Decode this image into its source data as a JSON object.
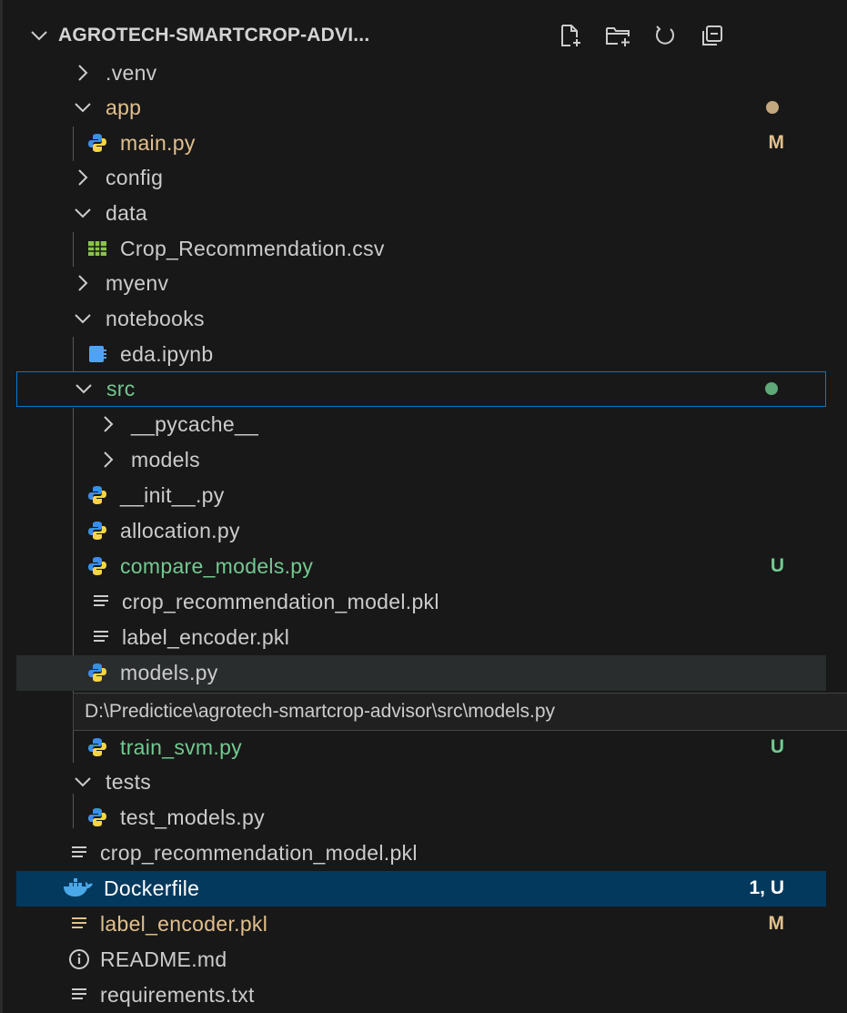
{
  "explorer": {
    "title": "AGROTECH-SMARTCROP-ADVI...",
    "header_icons": [
      "new-file-icon",
      "new-folder-icon",
      "refresh-icon",
      "collapse-all-icon"
    ]
  },
  "tree": {
    "venv": ".venv",
    "app": "app",
    "main_py": "main.py",
    "main_py_badge": "M",
    "config": "config",
    "data": "data",
    "crop_csv": "Crop_Recommendation.csv",
    "myenv": "myenv",
    "notebooks": "notebooks",
    "eda": "eda.ipynb",
    "src": "src",
    "pycache": "__pycache__",
    "models_folder": "models",
    "init_py": "__init__.py",
    "allocation_py": "allocation.py",
    "compare_models_py": "compare_models.py",
    "compare_models_badge": "U",
    "crop_model_pkl_src": "crop_recommendation_model.pkl",
    "label_encoder_pkl_src": "label_encoder.pkl",
    "models_py": "models.py",
    "train_svm_py": "train_svm.py",
    "train_svm_badge": "U",
    "tests": "tests",
    "test_models_py": "test_models.py",
    "crop_model_pkl_root": "crop_recommendation_model.pkl",
    "dockerfile": "Dockerfile",
    "dockerfile_badge": "1, U",
    "label_encoder_pkl_root": "label_encoder.pkl",
    "label_encoder_root_badge": "M",
    "readme": "README.md",
    "requirements": "requirements.txt"
  },
  "tooltip": {
    "path": "D:\\Predictice\\agrotech-smartcrop-advisor\\src\\models.py"
  },
  "colors": {
    "background": "#181818",
    "modified": "#e2c08d",
    "untracked": "#73c991",
    "selected": "#04395e",
    "focus_border": "#0078d4",
    "python_blue": "#3b8eea",
    "python_yellow": "#f5d547"
  }
}
